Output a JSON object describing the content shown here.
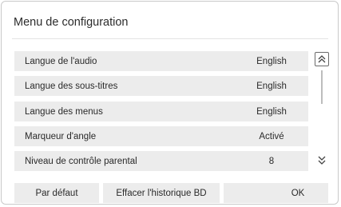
{
  "title": "Menu de configuration",
  "rows": [
    {
      "label": "Langue de l'audio",
      "value": "English"
    },
    {
      "label": "Langue des sous-titres",
      "value": "English"
    },
    {
      "label": "Langue des menus",
      "value": "English"
    },
    {
      "label": "Marqueur d'angle",
      "value": "Activé"
    },
    {
      "label": "Niveau de contrôle parental",
      "value": "8"
    }
  ],
  "buttons": {
    "default": "Par défaut",
    "clear_history": "Effacer l'historique BD",
    "ok": "OK"
  },
  "scrollbar": {
    "position": 0.0,
    "visible_fraction": 0.33
  }
}
